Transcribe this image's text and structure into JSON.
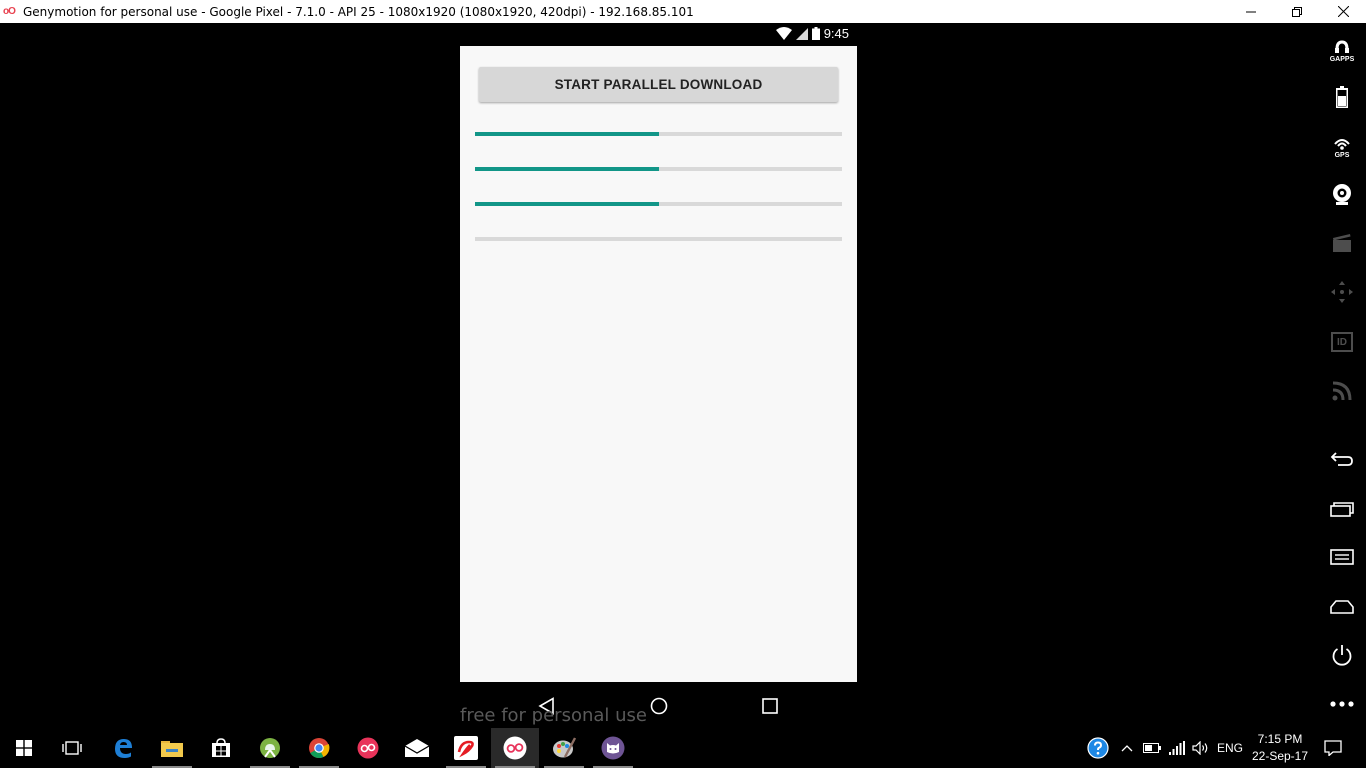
{
  "window": {
    "logo_text": "oO",
    "title": "Genymotion for personal use - Google Pixel - 7.1.0 - API 25 - 1080x1920 (1080x1920, 420dpi) - 192.168.85.101",
    "buttons": [
      "minimize-icon",
      "restore-icon",
      "close-icon"
    ]
  },
  "phone": {
    "statusbar": {
      "time": "9:45",
      "icons": [
        "wifi-icon",
        "signal-icon",
        "battery-icon"
      ]
    },
    "button_label": "START PARALLEL DOWNLOAD",
    "progress": [
      0.5,
      0.5,
      0.5,
      0.0
    ],
    "accent_color": "#129688",
    "nav": [
      "back-icon",
      "home-icon",
      "recents-icon"
    ],
    "watermark": "free for personal use"
  },
  "sidebar": {
    "items": [
      {
        "icon": "gapps-icon",
        "label": "GAPPS",
        "enabled": true
      },
      {
        "icon": "battery-icon",
        "enabled": true
      },
      {
        "icon": "gps-icon",
        "label": "GPS",
        "enabled": true
      },
      {
        "icon": "camera-icon",
        "enabled": true
      },
      {
        "icon": "capture-icon",
        "enabled": false
      },
      {
        "icon": "dpad-icon",
        "enabled": false
      },
      {
        "icon": "id-icon",
        "label": "ID",
        "enabled": false
      },
      {
        "icon": "rss-icon",
        "enabled": false
      },
      {
        "icon": "back-icon",
        "enabled": true
      },
      {
        "icon": "recent-apps-icon",
        "enabled": true
      },
      {
        "icon": "menu-icon",
        "enabled": true
      },
      {
        "icon": "home-icon",
        "enabled": true
      },
      {
        "icon": "power-icon",
        "enabled": true
      },
      {
        "icon": "more-icon",
        "enabled": true
      }
    ]
  },
  "taskbar": {
    "apps": [
      "start-icon",
      "task-view-icon",
      "edge-icon",
      "file-explorer-icon",
      "store-icon",
      "android-studio-icon",
      "chrome-icon",
      "genymotion-icon",
      "mail-icon",
      "airtel-icon",
      "genymotion-icon",
      "paint-icon",
      "github-icon"
    ],
    "tray": {
      "language": "ENG"
    },
    "clock": {
      "time": "7:15 PM",
      "date": "22-Sep-17"
    }
  }
}
